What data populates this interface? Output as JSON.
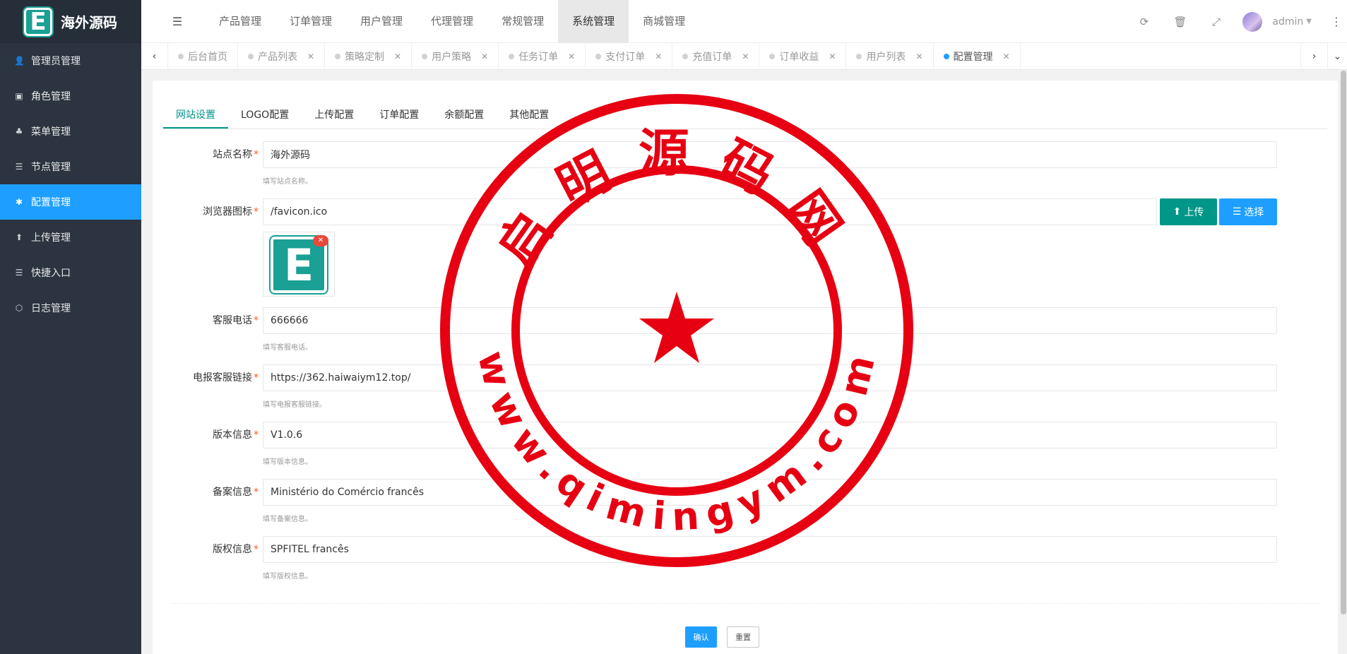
{
  "app": {
    "logo_letter": "E",
    "logo_text": "海外源码"
  },
  "sidebar": {
    "items": [
      {
        "icon": "user-icon",
        "glyph": "👤",
        "label": "管理员管理"
      },
      {
        "icon": "role-icon",
        "glyph": "▣",
        "label": "角色管理"
      },
      {
        "icon": "tree-icon",
        "glyph": "♣",
        "label": "菜单管理"
      },
      {
        "icon": "list-icon",
        "glyph": "☰",
        "label": "节点管理"
      },
      {
        "icon": "gear-icon",
        "glyph": "✱",
        "label": "配置管理",
        "active": true
      },
      {
        "icon": "upload-icon",
        "glyph": "⬆",
        "label": "上传管理"
      },
      {
        "icon": "shortcut-icon",
        "glyph": "☰",
        "label": "快捷入口"
      },
      {
        "icon": "log-icon",
        "glyph": "⬡",
        "label": "日志管理"
      }
    ]
  },
  "topnav": {
    "items": [
      "产品管理",
      "订单管理",
      "用户管理",
      "代理管理",
      "常规管理",
      "系统管理",
      "商城管理"
    ],
    "active": "系统管理"
  },
  "header": {
    "user": "admin"
  },
  "tabs": [
    {
      "label": "后台首页",
      "closable": false
    },
    {
      "label": "产品列表",
      "closable": true
    },
    {
      "label": "策略定制",
      "closable": true
    },
    {
      "label": "用户策略",
      "closable": true
    },
    {
      "label": "任务订单",
      "closable": true
    },
    {
      "label": "支付订单",
      "closable": true
    },
    {
      "label": "充值订单",
      "closable": true
    },
    {
      "label": "订单收益",
      "closable": true
    },
    {
      "label": "用户列表",
      "closable": true
    },
    {
      "label": "配置管理",
      "closable": true,
      "active": true
    }
  ],
  "subtabs": {
    "items": [
      "网站设置",
      "LOGO配置",
      "上传配置",
      "订单配置",
      "余额配置",
      "其他配置"
    ],
    "active": "网站设置"
  },
  "form": {
    "site_name": {
      "label": "站点名称",
      "value": "海外源码",
      "hint": "填写站点名称。"
    },
    "favicon": {
      "label": "浏览器图标",
      "value": "/favicon.ico",
      "upload_label": "上传",
      "select_label": "选择",
      "preview_letter": "E"
    },
    "phone": {
      "label": "客服电话",
      "value": "666666",
      "hint": "填写客服电话。"
    },
    "telegram": {
      "label": "电报客服链接",
      "value": "https://362.haiwaiym12.top/",
      "hint": "填写电报客服链接。"
    },
    "version": {
      "label": "版本信息",
      "value": "V1.0.6",
      "hint": "填写版本信息。"
    },
    "record": {
      "label": "备案信息",
      "value": "Ministério do Comércio francês",
      "hint": "填写备案信息。"
    },
    "copyright": {
      "label": "版权信息",
      "value": "SPFITEL francês",
      "hint": "填写版权信息。"
    },
    "required_mark": "*",
    "confirm_label": "确认",
    "reset_label": "重置"
  },
  "watermark": {
    "top_text": "启明源码网",
    "bottom_text": "www.qimingym.com",
    "color": "#e60012"
  },
  "colors": {
    "sidebar_bg": "#2b3440",
    "active_blue": "#1e9fff",
    "teal": "#009688",
    "required": "#ff5722"
  }
}
